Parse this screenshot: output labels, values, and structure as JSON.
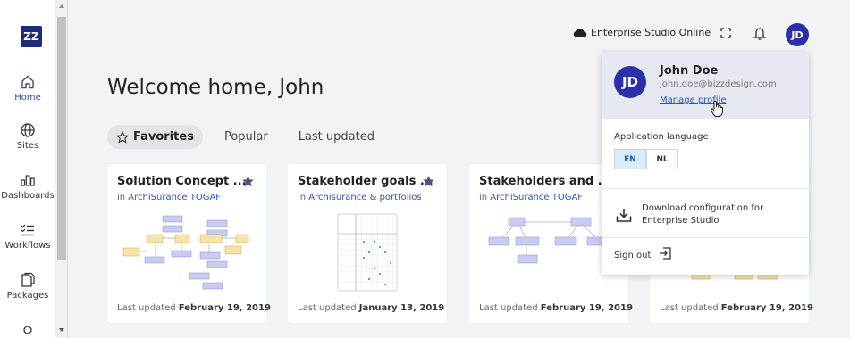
{
  "app": {
    "logo_text": "ZZ",
    "environment": "Enterprise Studio Online",
    "user_initials": "JD"
  },
  "sidebar": {
    "items": [
      {
        "label": "Home",
        "icon": "home-icon"
      },
      {
        "label": "Sites",
        "icon": "globe-icon"
      },
      {
        "label": "Dashboards",
        "icon": "chart-icon"
      },
      {
        "label": "Workflows",
        "icon": "list-check-icon"
      },
      {
        "label": "Packages",
        "icon": "package-icon"
      }
    ]
  },
  "main": {
    "welcome": "Welcome home, John",
    "tabs": [
      {
        "label": "Favorites",
        "active": true
      },
      {
        "label": "Popular"
      },
      {
        "label": "Last updated"
      }
    ],
    "cards": [
      {
        "title": "Solution Concept ...",
        "in_prefix": "in ",
        "in_link": "ArchiSurance TOGAF",
        "updated_prefix": "Last updated ",
        "updated_date": "February 19, 2019"
      },
      {
        "title": "Stakeholder goals ...",
        "in_prefix": "in ",
        "in_link": "Archisurance & portfolios",
        "updated_prefix": "Last updated ",
        "updated_date": "January 13, 2019"
      },
      {
        "title": "Stakeholders and ...",
        "in_prefix": "in ",
        "in_link": "ArchiSurance TOGAF",
        "updated_prefix": "Last updated ",
        "updated_date": "February 19, 2019"
      },
      {
        "title": "",
        "in_prefix": "",
        "in_link": "",
        "updated_prefix": "Last updated ",
        "updated_date": "February 19, 2019"
      }
    ]
  },
  "profile_menu": {
    "initials": "JD",
    "name": "John Doe",
    "email": "john.doe@bizzdesign.com",
    "manage": "Manage profile",
    "language_label": "Application language",
    "languages": [
      "EN",
      "NL"
    ],
    "selected_language": "EN",
    "download": "Download configuration for Enterprise Studio",
    "signout": "Sign out"
  },
  "colors": {
    "brand": "#1e2a7a",
    "avatar": "#2b2fa8",
    "link": "#2b55b8",
    "star": "#4a5580",
    "diagram_box": "#f6e3a8",
    "diagram_box_blue": "#c9ccf2"
  }
}
